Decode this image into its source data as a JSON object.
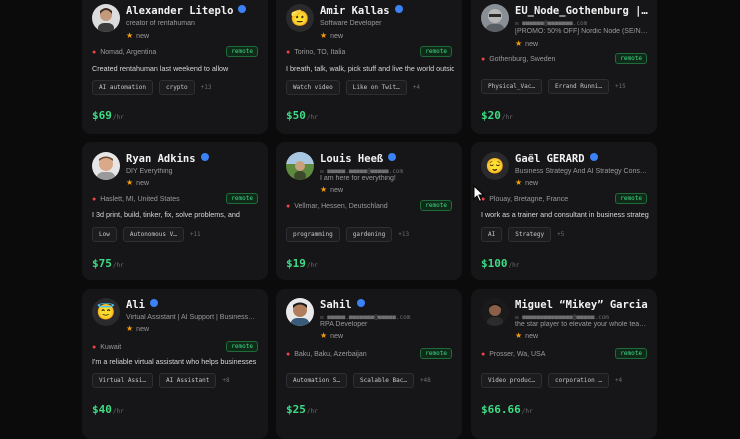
{
  "colors": {
    "accent_green": "#3ddc84",
    "verified_blue": "#3b82f6",
    "star": "#f59e0b",
    "pin": "#ef4444"
  },
  "common": {
    "new_label": "new",
    "remote_label": "remote",
    "per_hour": "/hr",
    "star_icon": "star-icon",
    "pin_icon": "map-pin-icon"
  },
  "cards": [
    {
      "name": "Alexander Liteplo",
      "line1": "creator of rentahuman",
      "line2": "",
      "location": "Nomad, Argentina",
      "bio": "Created rentahuman last weekend to allow",
      "tags": [
        "AI automation",
        "crypto"
      ],
      "more": "+13",
      "price": "$69"
    },
    {
      "name": "Amir Kallas",
      "line1": "Software Developer",
      "line2": "",
      "location": "Torino, TO, Italia",
      "bio": "I breath, talk, walk, pick stuff and live the world outside",
      "tags": [
        "Watch video",
        "Like on Twit…"
      ],
      "more": "+4",
      "price": "$50"
    },
    {
      "name": "EU_Node_Gothenburg |…",
      "line1": "✉ ■■■■■■@■■■■■■■.com",
      "line2": "[PROMO: 50% OFF] Nordic Node (SE/N…",
      "location": "Gothenburg, Sweden",
      "bio": "",
      "tags": [
        "Physical_Vac…",
        "Errand Runni…"
      ],
      "more": "+15",
      "price": "$20"
    },
    {
      "name": "Ryan Adkins",
      "line1": "DIY Everything",
      "line2": "",
      "location": "Haslett, MI, United States",
      "bio": "I 3d print, build, tinker, fix, solve problems, and",
      "tags": [
        "Low",
        "Autonomous V…"
      ],
      "more": "+11",
      "price": "$75"
    },
    {
      "name": "Louis Heeß",
      "line1": "✉ ■■■■■.■■■■■@■■■■■.com",
      "line2": "I am here for everything!",
      "location": "Vellmar, Hessen, Deutschland",
      "bio": "",
      "tags": [
        "programming",
        "gardening"
      ],
      "more": "+13",
      "price": "$19"
    },
    {
      "name": "Gaël GERARD",
      "line1": "Business Strategy And AI Strategy Cons…",
      "line2": "",
      "location": "Plouay, Bretagne, France",
      "bio": "I work as a trainer and consultant in business strategy",
      "tags": [
        "AI",
        "Strategy"
      ],
      "more": "+5",
      "price": "$100"
    },
    {
      "name": "Ali",
      "line1": "Virtual Assistant | AI Support | Business…",
      "line2": "",
      "location": "Kuwait",
      "bio": "I'm a reliable virtual assistant who helps businesses",
      "tags": [
        "Virtual Assi…",
        "AI Assistant"
      ],
      "more": "+8",
      "price": "$40"
    },
    {
      "name": "Sahil",
      "line1": "✉ ■■■■■.■■■■■■■@■■■■■.com",
      "line2": "RPA Developer",
      "location": "Baku, Baku, Azerbaijan",
      "bio": "",
      "tags": [
        "Automation S…",
        "Scalable Bac…"
      ],
      "more": "+48",
      "price": "$25"
    },
    {
      "name": "Miguel “Mikey” Garcia",
      "line1": "✉ ■■■■■■■■■■■■■■@■■■■■.com",
      "line2": "the star player to elevate your whole tea…",
      "location": "Prosser, Wa, USA",
      "bio": "",
      "tags": [
        "Video produc…",
        "corporation …"
      ],
      "more": "+4",
      "price": "$66.66"
    }
  ]
}
